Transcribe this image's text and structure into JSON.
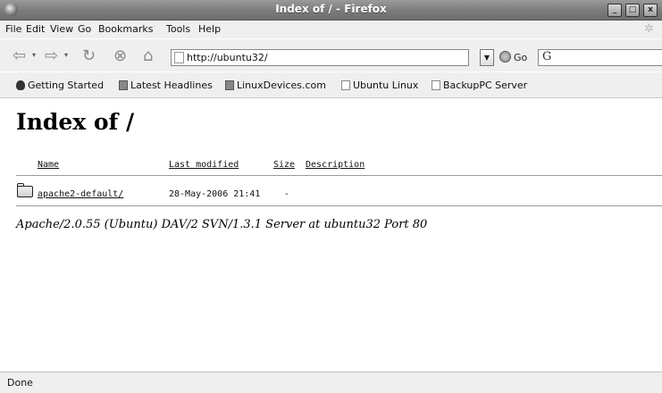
{
  "window": {
    "title": "Index of / - Firefox",
    "minimize": "_",
    "maximize": "□",
    "close": "x"
  },
  "menu": [
    "File",
    "Edit",
    "View",
    "Go",
    "Bookmarks",
    "Tools",
    "Help"
  ],
  "toolbar": {
    "url": "http://ubuntu32/",
    "go_label": "Go",
    "search_glyph": "G",
    "icons": [
      "back-icon",
      "forward-icon",
      "reload-icon",
      "stop-icon",
      "home-icon"
    ]
  },
  "bookmarks": [
    {
      "label": "Getting Started",
      "icon": "getting-started-icon"
    },
    {
      "label": "Latest Headlines",
      "icon": "feed-icon"
    },
    {
      "label": "LinuxDevices.com",
      "icon": "feed-icon"
    },
    {
      "label": "Ubuntu Linux",
      "icon": "page-icon"
    },
    {
      "label": "BackupPC Server",
      "icon": "page-icon"
    }
  ],
  "page": {
    "heading": "Index of /",
    "columns": [
      "Name",
      "Last modified",
      "Size",
      "Description"
    ],
    "rows": [
      {
        "name": "apache2-default/",
        "modified": "28-May-2006 21:41",
        "size": "-",
        "description": ""
      }
    ],
    "address": "Apache/2.0.55 (Ubuntu) DAV/2 SVN/1.3.1 Server at ubuntu32 Port 80"
  },
  "status": "Done",
  "colors": {
    "titlebar": "#7b7b7b",
    "chrome": "#efefef",
    "link": "#111111"
  }
}
